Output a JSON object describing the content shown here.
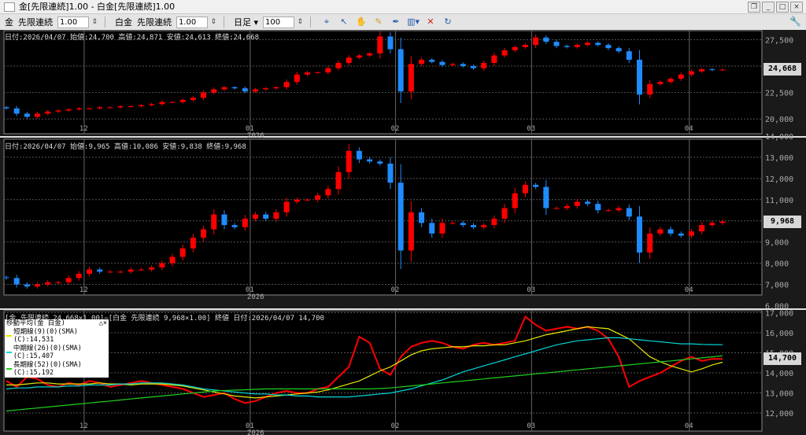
{
  "window": {
    "title": "金[先限連続]1.00 - 白金[先限連続]1.00"
  },
  "toolbar": {
    "sym1": "金",
    "contract1": "先限連続",
    "mult1": "1.00",
    "sym2": "白金",
    "contract2": "先限連続",
    "mult2": "1.00",
    "period": "日足 ▾",
    "count": "100",
    "icons": [
      "cursor-icon",
      "select-icon",
      "hand-icon",
      "pencil-icon",
      "draw-icon",
      "bar-chart-icon",
      "delete-line-icon",
      "refresh-icon"
    ]
  },
  "colors": {
    "up": "#ff0000",
    "down": "#1e8cff",
    "sma_short": "#e8e800",
    "sma_mid": "#00d8d8",
    "sma_long": "#20d020",
    "ratio": "#ff0000"
  },
  "month_ticks": [
    {
      "label": "12",
      "at_bar": 7.5
    },
    {
      "label": "01",
      "at_bar": 23.5,
      "year": "2026"
    },
    {
      "label": "02",
      "at_bar": 37.5
    },
    {
      "label": "03",
      "at_bar": 50.6
    },
    {
      "label": "04",
      "at_bar": 65.8
    }
  ],
  "panel1": {
    "info": "日付:2026/04/07 始値:24,700 高値:24,871 安値:24,613 終値:24,668",
    "last": "24,668"
  },
  "panel2": {
    "info": "日付:2026/04/07 始値:9,965 高値:10,086 安値:9,838 終値:9,968",
    "last": "9,968"
  },
  "panel3": {
    "info": "[金 先限連続 24,668×1.00]−[白金 先限連続 9,968×1.00] 終値 日付:2026/04/07 14,700",
    "last": "14,700",
    "legend_title": "移動平均(金 白金)",
    "legend_ctrl": "△×",
    "legend": [
      "短期線(9)(0)(SMA)(C):14,531",
      "中期線(26)(0)(SMA)(C):15,407",
      "長期線(52)(0)(SMA)(C):15,192"
    ]
  },
  "chart_data": [
    {
      "type": "candlestick",
      "name": "金[先限連続]",
      "ylim": [
        18600,
        28350
      ],
      "ticks": [
        "20,000",
        "22,500",
        "25,000",
        "27,500"
      ],
      "tick_values": [
        20000,
        22500,
        25000,
        27500
      ],
      "close": [
        21000,
        20500,
        20200,
        20500,
        20700,
        20800,
        20900,
        21000,
        21000,
        21100,
        21100,
        21200,
        21200,
        21300,
        21400,
        21600,
        21600,
        21800,
        22000,
        22500,
        22800,
        23000,
        22900,
        22600,
        22800,
        22900,
        23000,
        23500,
        24200,
        24400,
        24400,
        24800,
        25300,
        25800,
        26000,
        26200,
        27800,
        26600,
        22600,
        25200,
        25600,
        25400,
        25100,
        25200,
        25000,
        24800,
        25300,
        26000,
        26500,
        26800,
        27000,
        27700,
        27300,
        26900,
        26800,
        27000,
        27200,
        27000,
        26700,
        26400,
        25600,
        22300,
        23300,
        23500,
        23800,
        24200,
        24500,
        24700,
        24650,
        24668
      ]
    },
    {
      "type": "candlestick",
      "name": "白金[先限連続]",
      "ylim": [
        6500,
        13850
      ],
      "ticks": [
        "6,000",
        "7,000",
        "8,000",
        "9,000",
        "10,000",
        "11,000",
        "12,000",
        "13,000",
        "14,000"
      ],
      "tick_values": [
        6000,
        7000,
        8000,
        9000,
        10000,
        11000,
        12000,
        13000,
        14000
      ],
      "close": [
        7300,
        7000,
        6900,
        7000,
        7100,
        7100,
        7300,
        7500,
        7700,
        7600,
        7600,
        7600,
        7700,
        7700,
        7800,
        8000,
        8300,
        8700,
        9200,
        9600,
        10300,
        9800,
        9700,
        10100,
        10300,
        10100,
        10400,
        10900,
        11000,
        11000,
        11200,
        11500,
        12300,
        13300,
        12900,
        12800,
        12700,
        11800,
        8600,
        10400,
        9900,
        9400,
        9900,
        9900,
        9800,
        9700,
        9800,
        10100,
        10600,
        11300,
        11700,
        11600,
        10600,
        10600,
        10700,
        10900,
        10800,
        10500,
        10500,
        10600,
        10200,
        8500,
        9400,
        9600,
        9400,
        9300,
        9500,
        9800,
        9900,
        9968
      ]
    },
    {
      "type": "line",
      "name": "金−白金",
      "ylim": [
        11100,
        17100
      ],
      "ticks": [
        "12,000",
        "13,000",
        "14,000",
        "15,000",
        "16,000",
        "17,000"
      ],
      "tick_values": [
        12000,
        13000,
        14000,
        15000,
        16000,
        17000
      ],
      "series": [
        {
          "key": "ratio",
          "values": [
            13600,
            13300,
            13800,
            13700,
            13400,
            13300,
            13500,
            13400,
            13600,
            13500,
            13300,
            13400,
            13500,
            13600,
            13500,
            13400,
            13300,
            13200,
            13000,
            12800,
            12900,
            13000,
            12700,
            12500,
            12600,
            12800,
            13000,
            13100,
            13000,
            13000,
            13200,
            13300,
            13800,
            14300,
            15800,
            15500,
            14200,
            13900,
            14800,
            15300,
            15500,
            15600,
            15500,
            15300,
            15200,
            15400,
            15500,
            15400,
            15500,
            15600,
            16800,
            16400,
            16100,
            16200,
            16300,
            16200,
            16300,
            16100,
            15700,
            14800,
            13300,
            13600,
            13800,
            14000,
            14300,
            14600,
            14800,
            14600,
            14700,
            14700
          ]
        },
        {
          "key": "sma_short",
          "values": [
            13400,
            13400,
            13450,
            13500,
            13500,
            13450,
            13450,
            13450,
            13450,
            13500,
            13450,
            13450,
            13400,
            13450,
            13450,
            13450,
            13400,
            13350,
            13250,
            13150,
            13050,
            12950,
            12850,
            12800,
            12750,
            12800,
            12850,
            12900,
            12950,
            13000,
            13050,
            13150,
            13300,
            13450,
            13600,
            13850,
            14100,
            14300,
            14600,
            14900,
            15100,
            15200,
            15250,
            15300,
            15300,
            15350,
            15350,
            15400,
            15400,
            15500,
            15600,
            15750,
            15900,
            16000,
            16100,
            16200,
            16300,
            16250,
            16200,
            15950,
            15700,
            15250,
            14800,
            14550,
            14350,
            14200,
            14050,
            14200,
            14400,
            14531
          ]
        },
        {
          "key": "sma_mid",
          "values": [
            13200,
            13250,
            13250,
            13300,
            13300,
            13300,
            13350,
            13350,
            13400,
            13400,
            13400,
            13450,
            13450,
            13500,
            13500,
            13500,
            13450,
            13400,
            13300,
            13200,
            13150,
            13100,
            13050,
            13000,
            12950,
            12950,
            12900,
            12900,
            12850,
            12850,
            12800,
            12800,
            12800,
            12800,
            12850,
            12900,
            12950,
            13000,
            13100,
            13200,
            13350,
            13500,
            13650,
            13850,
            14050,
            14200,
            14350,
            14500,
            14650,
            14800,
            14950,
            15100,
            15250,
            15400,
            15500,
            15600,
            15650,
            15700,
            15750,
            15750,
            15700,
            15650,
            15600,
            15550,
            15500,
            15450,
            15450,
            15420,
            15410,
            15407
          ]
        },
        {
          "key": "sma_long",
          "values": [
            12100,
            12150,
            12200,
            12250,
            12300,
            12350,
            12400,
            12450,
            12500,
            12550,
            12600,
            12650,
            12700,
            12750,
            12800,
            12850,
            12900,
            12950,
            13000,
            13050,
            13100,
            13120,
            13140,
            13160,
            13180,
            13200,
            13200,
            13200,
            13200,
            13200,
            13200,
            13200,
            13200,
            13200,
            13200,
            13200,
            13220,
            13250,
            13300,
            13350,
            13400,
            13450,
            13500,
            13550,
            13600,
            13650,
            13700,
            13750,
            13800,
            13850,
            13900,
            13950,
            14000,
            14050,
            14100,
            14150,
            14200,
            14250,
            14300,
            14350,
            14400,
            14450,
            14500,
            14550,
            14600,
            14650,
            14700,
            14750,
            14800,
            14850
          ]
        }
      ]
    }
  ]
}
